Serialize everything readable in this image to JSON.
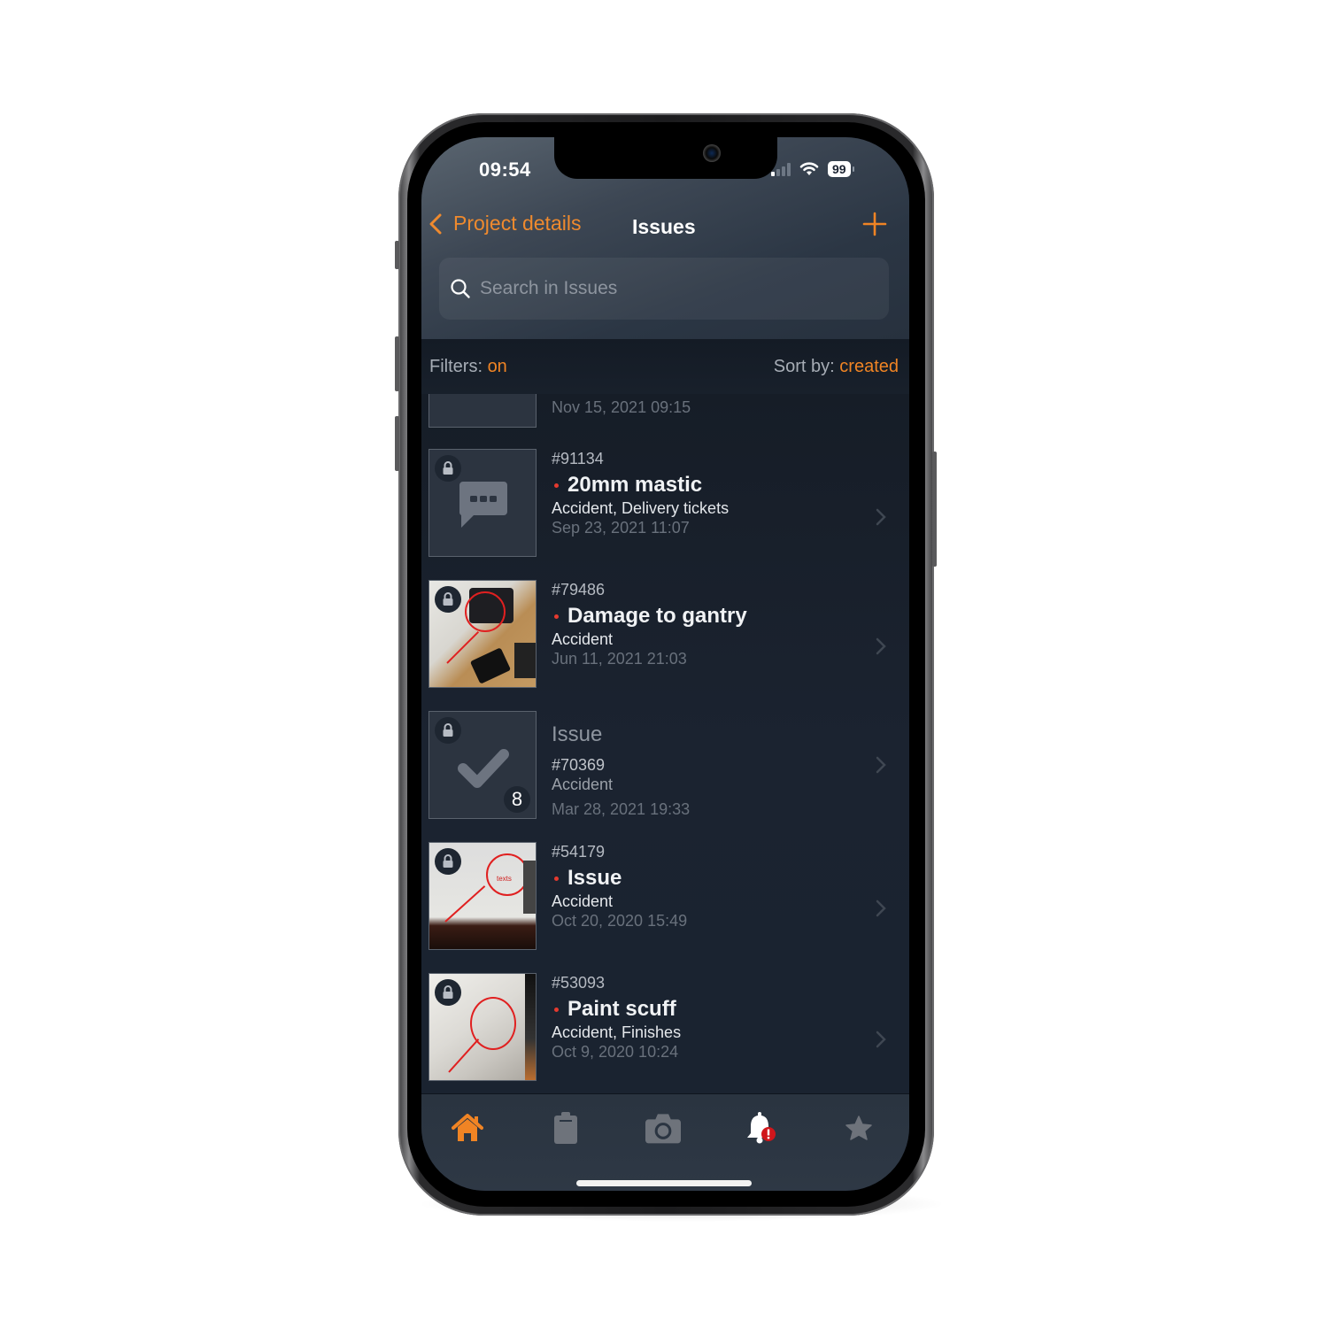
{
  "status_bar": {
    "time": "09:54",
    "battery": "99",
    "signal_bars_on": 1,
    "signal_bars_total": 4
  },
  "nav": {
    "back_label": "Project details",
    "title": "Issues",
    "add_icon": "plus-icon"
  },
  "search": {
    "placeholder": "Search in Issues",
    "value": ""
  },
  "filter_bar": {
    "filters_label": "Filters: ",
    "filters_value": "on",
    "sort_label": "Sort by: ",
    "sort_value": "created"
  },
  "issues": [
    {
      "partial": true,
      "date": "Nov 15, 2021 09:15"
    },
    {
      "number": "#91134",
      "title": "20mm mastic",
      "categories": "Accident, Delivery tickets",
      "date": "Sep 23, 2021 11:07",
      "thumbnail": "comment-icon",
      "locked": true,
      "unread": true
    },
    {
      "number": "#79486",
      "title": "Damage to gantry",
      "categories": "Accident",
      "date": "Jun 11, 2021 21:03",
      "thumbnail": "photo",
      "locked": true,
      "unread": true
    },
    {
      "number": "#70369",
      "title": "Issue",
      "categories": "Accident",
      "date": "Mar 28, 2021 19:33",
      "thumbnail": "checkmark-icon",
      "count": "8",
      "locked": true,
      "unread": false
    },
    {
      "number": "#54179",
      "title": "Issue",
      "categories": "Accident",
      "date": "Oct 20, 2020 15:49",
      "thumbnail": "photo",
      "photo_annotation": "texts",
      "locked": true,
      "unread": true
    },
    {
      "number": "#53093",
      "title": "Paint scuff",
      "categories": "Accident, Finishes",
      "date": "Oct 9, 2020 10:24",
      "thumbnail": "photo",
      "locked": true,
      "unread": true
    }
  ],
  "tab_bar": {
    "tabs": [
      {
        "icon": "home-icon",
        "active": true
      },
      {
        "icon": "clipboard-icon",
        "active": false
      },
      {
        "icon": "camera-icon",
        "active": false
      },
      {
        "icon": "bell-icon",
        "active": false,
        "alert_badge": "!"
      },
      {
        "icon": "star-icon",
        "active": false
      }
    ]
  },
  "colors": {
    "accent": "#f08424",
    "unread_dot": "#e53a2f",
    "alert_badge": "#d0161b",
    "background": "#1a2230"
  }
}
